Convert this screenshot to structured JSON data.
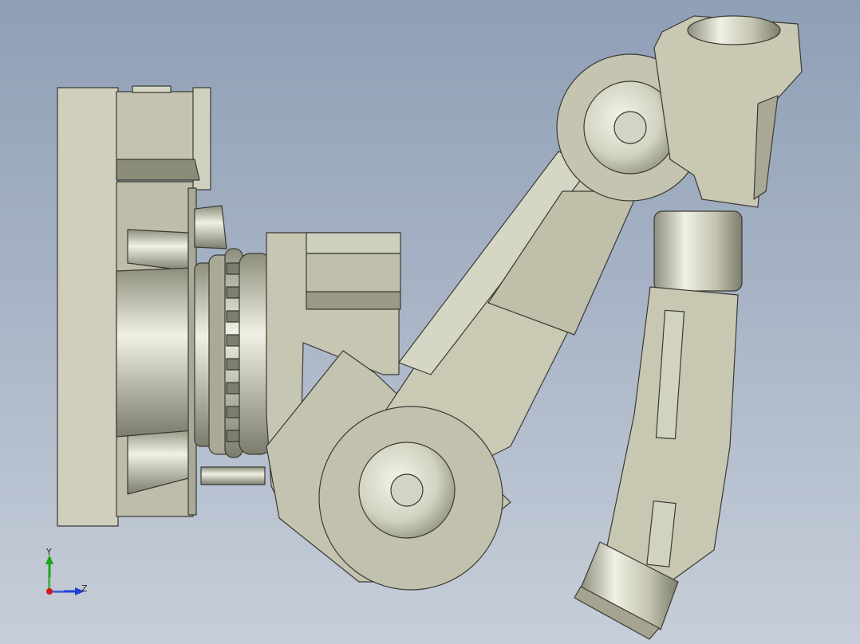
{
  "triad": {
    "y_label": "Y",
    "z_label": "Z",
    "colors": {
      "y": "#19a519",
      "z": "#1f3fd8",
      "origin": "#d01818"
    }
  },
  "colors": {
    "background_top": "#8f9fb6",
    "background_bottom": "#c7ced9",
    "part_body": "#c9c9b4",
    "part_light": "#dcdccc",
    "part_shade": "#9a9a86",
    "edge": "#3a3a34"
  }
}
